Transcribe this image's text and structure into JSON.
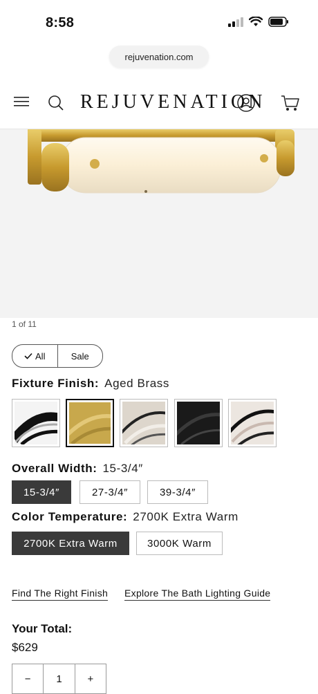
{
  "status_bar": {
    "time": "8:58"
  },
  "browser": {
    "url": "rejuvenation.com"
  },
  "header": {
    "brand": "REJUVENATION"
  },
  "gallery": {
    "counter": "1 of 11"
  },
  "filters": {
    "all_label": "All",
    "sale_label": "Sale"
  },
  "finish": {
    "label": "Fixture Finish:",
    "value": "Aged Brass",
    "swatches": [
      {
        "name": "polished-nickel",
        "color": "#e8e8e8"
      },
      {
        "name": "aged-brass",
        "color": "#c9a94a"
      },
      {
        "name": "satin-nickel",
        "color": "#cfc8bf"
      },
      {
        "name": "matte-black",
        "color": "#1c1c1c"
      },
      {
        "name": "polished-nickel-alt",
        "color": "#dcd5cf"
      }
    ]
  },
  "width": {
    "label": "Overall Width:",
    "value": "15-3/4″",
    "options": [
      "15-3/4″",
      "27-3/4″",
      "39-3/4″"
    ]
  },
  "color_temp": {
    "label": "Color Temperature:",
    "value": "2700K Extra Warm",
    "options": [
      "2700K Extra Warm",
      "3000K Warm"
    ]
  },
  "links": {
    "finish_guide": "Find The Right Finish",
    "bath_guide": "Explore The Bath Lighting Guide"
  },
  "total": {
    "label": "Your Total:",
    "price": "$629"
  },
  "quantity": {
    "minus": "−",
    "value": "1",
    "plus": "+"
  }
}
